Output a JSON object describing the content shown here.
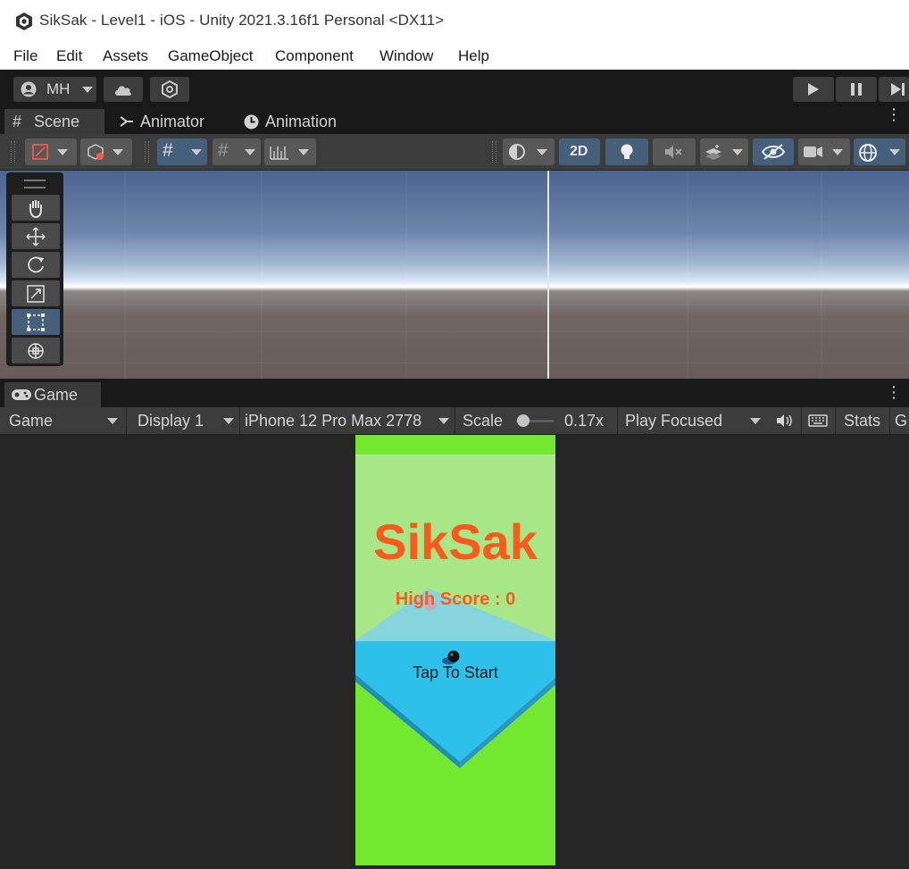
{
  "window": {
    "title": "SikSak - Level1 - iOS - Unity 2021.3.16f1 Personal <DX11>"
  },
  "menu": {
    "items": [
      "File",
      "Edit",
      "Assets",
      "GameObject",
      "Component",
      "Window",
      "Help"
    ]
  },
  "toolbar": {
    "account_label": "MH"
  },
  "scene_tabs": {
    "tabs": [
      {
        "label": "Scene",
        "icon": "hash-icon",
        "active": true
      },
      {
        "label": "Animator",
        "icon": "animator-icon",
        "active": false
      },
      {
        "label": "Animation",
        "icon": "clock-icon",
        "active": false
      }
    ]
  },
  "scene_toolbar": {
    "mode_2d_label": "2D"
  },
  "game_tab": {
    "label": "Game",
    "icon": "gamepad-icon"
  },
  "game_toolbar": {
    "view_select": "Game",
    "display_select": "Display 1",
    "device_select": "iPhone 12 Pro Max  2778",
    "scale_label": "Scale",
    "scale_value": "0.17x",
    "scale_slider_value": 0.0,
    "play_mode_select": "Play Focused",
    "stats_label": "Stats",
    "gizmos_label": "G"
  },
  "game": {
    "title": "SikSak",
    "high_score": "High Score : 0",
    "tap_to_start": "Tap To Start"
  },
  "colors": {
    "unity_dark": "#191919",
    "panel": "#3c3c3c",
    "accent_blue": "#46607c",
    "game_green": "#73e82e",
    "platform_blue": "#2cc0ea",
    "title_orange": "#ff5a1e"
  }
}
